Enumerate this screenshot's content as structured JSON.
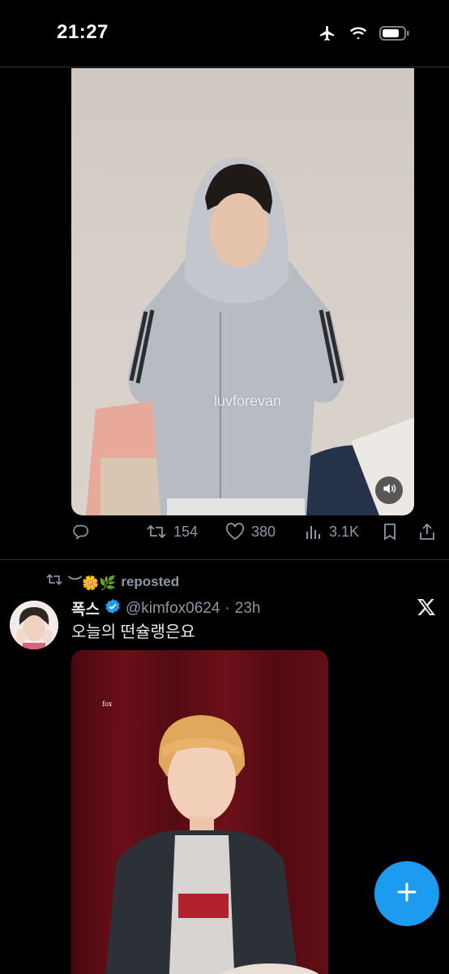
{
  "status_bar": {
    "time": "21:27"
  },
  "tweet_1": {
    "watermark": "luvforevan",
    "stats": {
      "reposts": "154",
      "likes": "380",
      "views": "3.1K"
    }
  },
  "tweet_2": {
    "repost_label": "reposted",
    "reposter_emoji": "︶🌼🌿",
    "display_name": "폭스",
    "handle": "@kimfox0624",
    "separator": "·",
    "time": "23h",
    "text": "오늘의 떤슐랭은요",
    "watermark": "fox"
  },
  "colors": {
    "accent": "#1d9bf0",
    "muted": "#8b98a5",
    "background": "#000000"
  },
  "icons": [
    "airplane-icon",
    "wifi-icon",
    "battery-icon",
    "reply-icon",
    "repost-icon",
    "like-icon",
    "views-icon",
    "bookmark-icon",
    "share-icon",
    "x-logo-icon",
    "compose-plus-icon",
    "volume-icon",
    "verified-badge-icon"
  ]
}
